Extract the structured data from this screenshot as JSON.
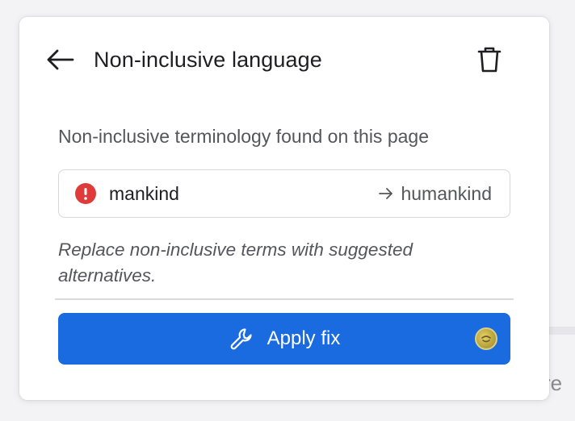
{
  "background": {
    "partial_text": "cre"
  },
  "panel": {
    "title": "Non-inclusive language",
    "subtitle": "Non-inclusive terminology found on this page",
    "issues": [
      {
        "term": "mankind",
        "suggestion": "humankind",
        "severity": "error"
      }
    ],
    "hint": "Replace non-inclusive terms with suggested alternatives.",
    "apply_button": {
      "label": "Apply fix"
    }
  },
  "icons": {
    "back": "arrow-left-icon",
    "delete": "trash-icon",
    "alert": "exclamation-circle-icon",
    "arrow": "arrow-right-icon",
    "wrench": "wrench-icon",
    "badge": "avatar-badge-icon"
  },
  "colors": {
    "accent": "#1a6ae0",
    "error": "#e03b3b",
    "text_primary": "#1f1f23",
    "text_secondary": "#55565c"
  }
}
